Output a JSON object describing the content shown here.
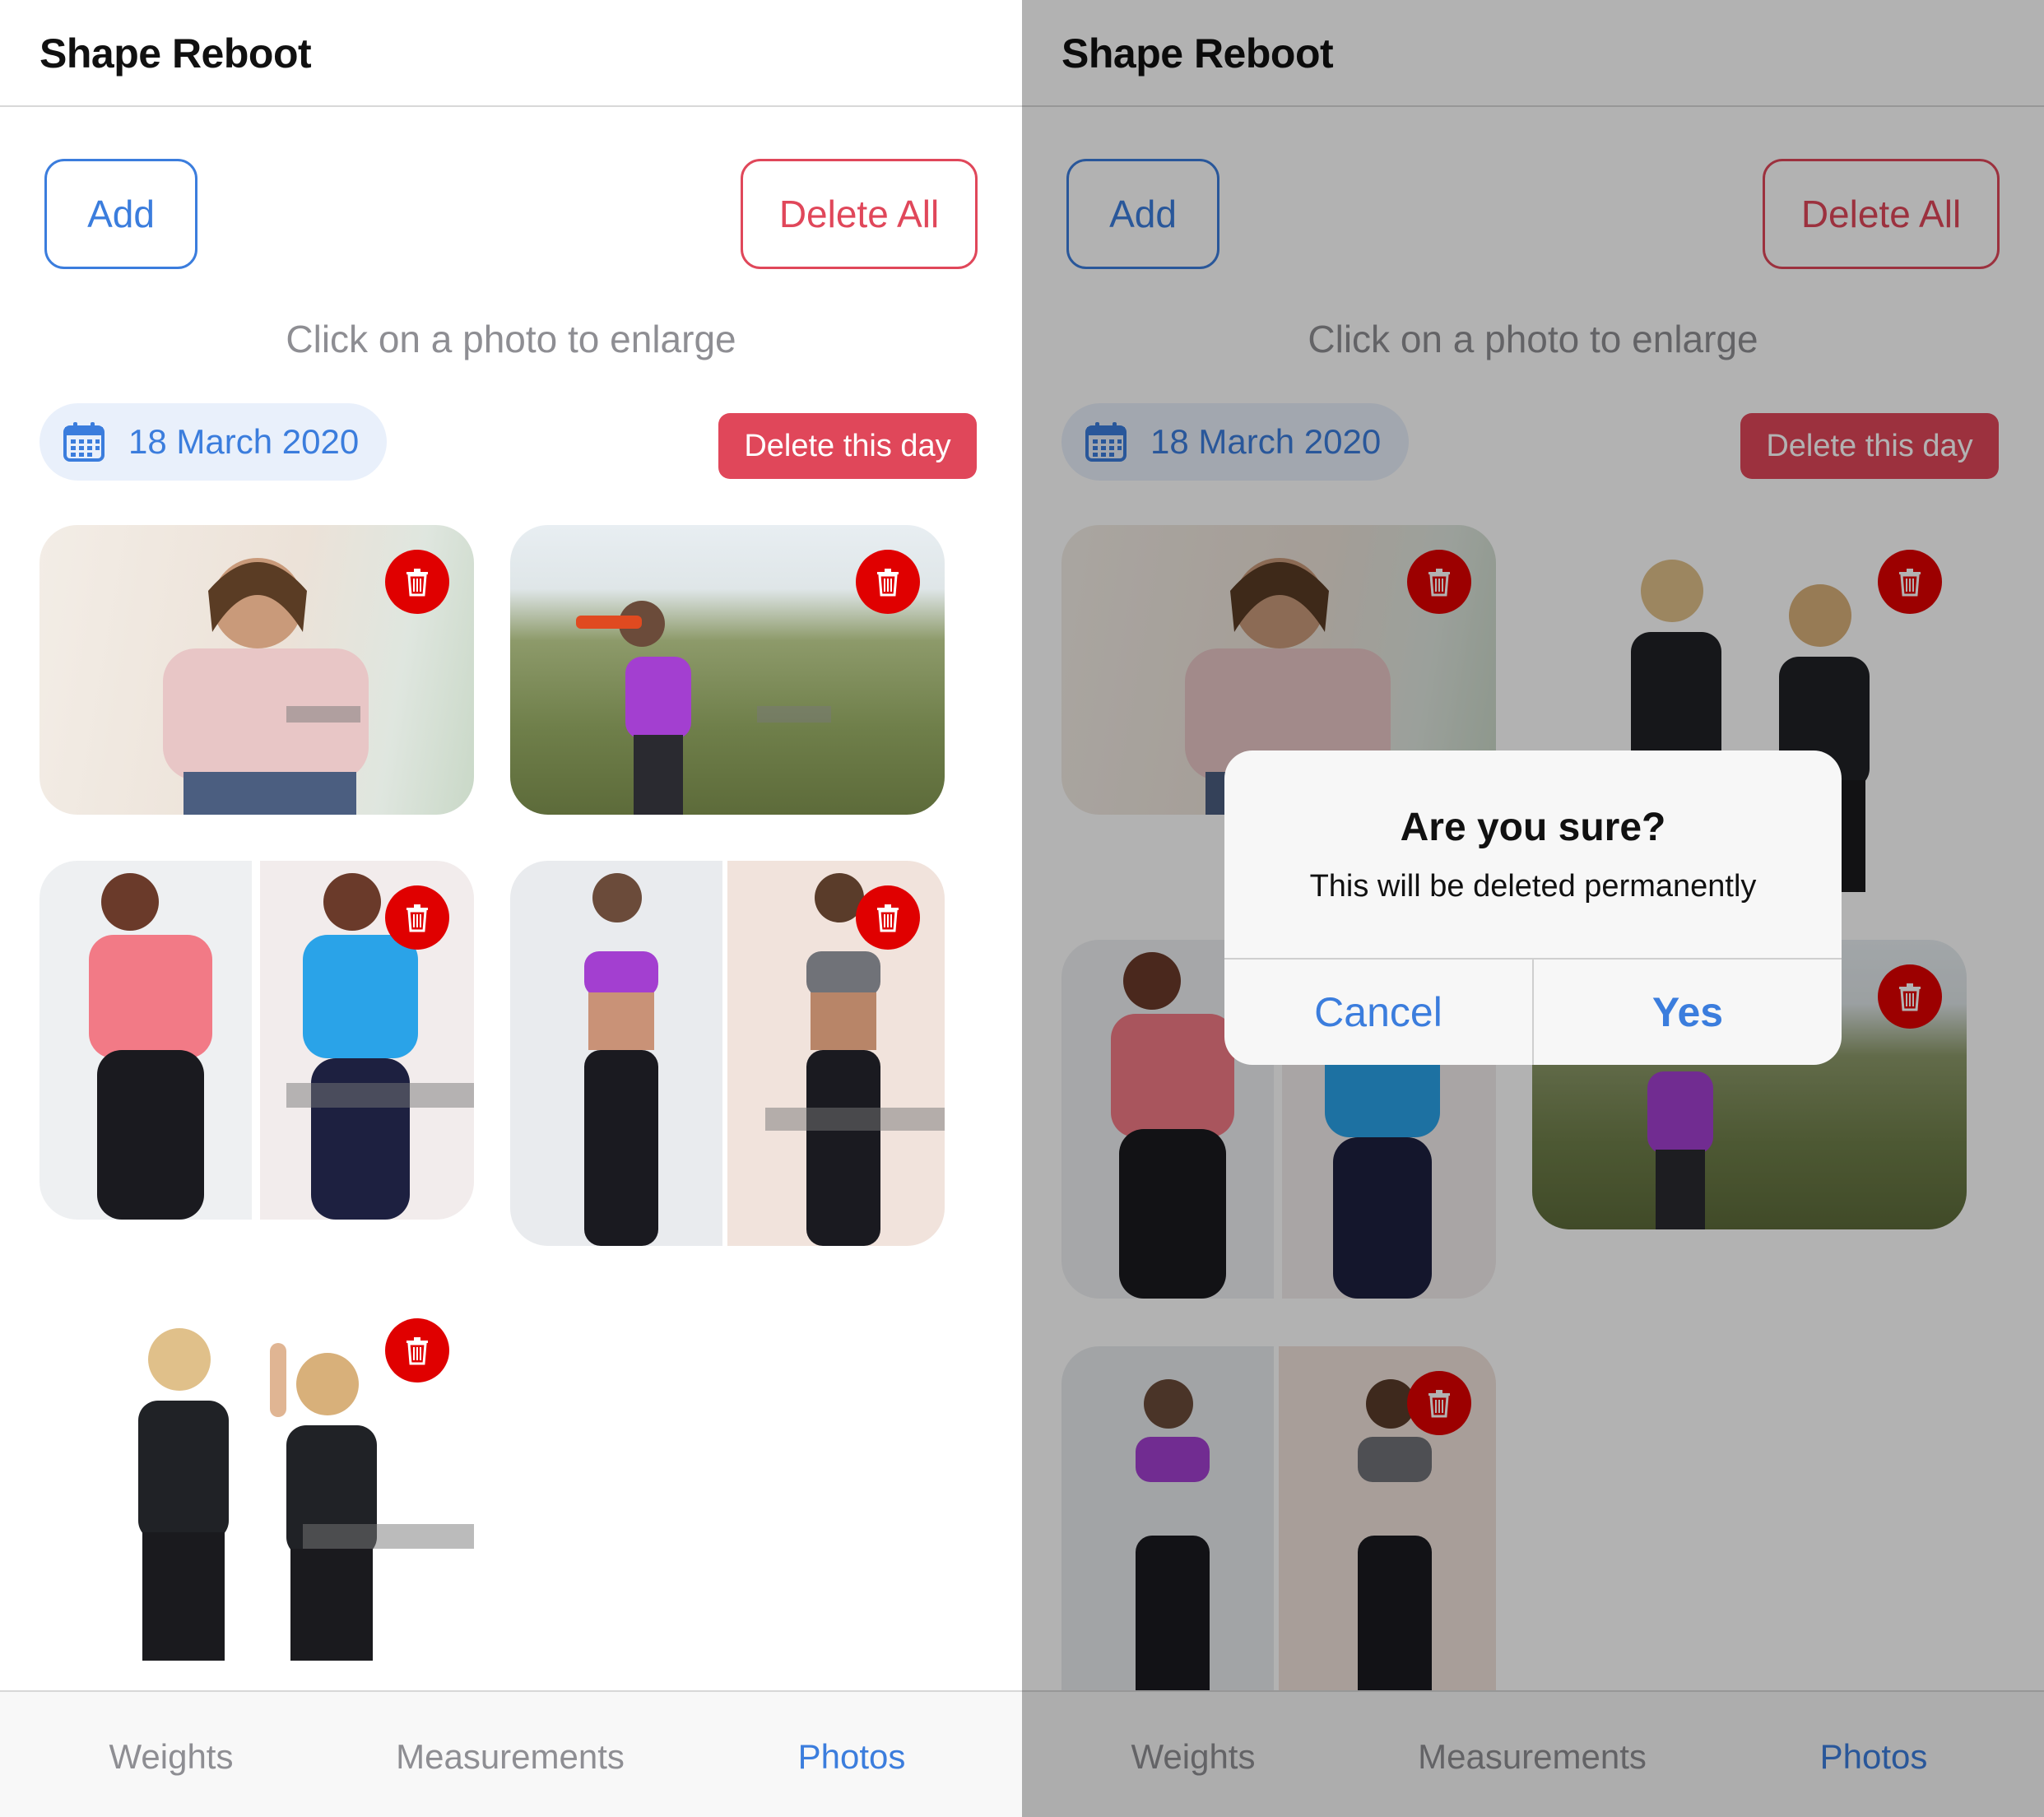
{
  "app": {
    "title": "Shape Reboot"
  },
  "toolbar": {
    "add_label": "Add",
    "delete_all_label": "Delete All"
  },
  "hint": "Click on a photo to enlarge",
  "day": {
    "date": "18 March 2020",
    "delete_day_label": "Delete this day"
  },
  "tabs": [
    {
      "label": "Weights",
      "active": false
    },
    {
      "label": "Measurements",
      "active": false
    },
    {
      "label": "Photos",
      "active": true
    }
  ],
  "dialog": {
    "title": "Are you sure?",
    "message": "This will be deleted permanently",
    "cancel_label": "Cancel",
    "confirm_label": "Yes"
  },
  "icons": {
    "calendar": "calendar-icon",
    "delete": "trash-icon"
  },
  "colors": {
    "accent": "#3b7ddd",
    "danger": "#e0475a",
    "trash": "#e00000"
  }
}
